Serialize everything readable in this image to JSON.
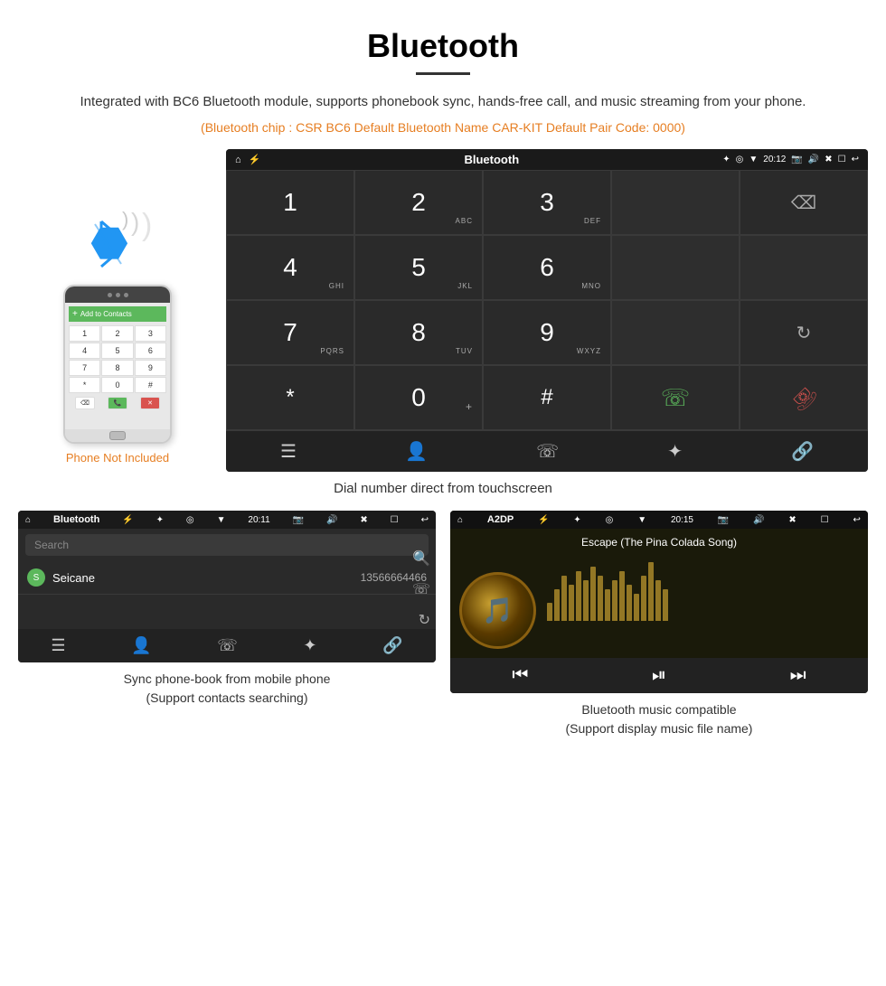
{
  "header": {
    "title": "Bluetooth",
    "description": "Integrated with BC6 Bluetooth module, supports phonebook sync, hands-free call, and music streaming from your phone.",
    "specs": "(Bluetooth chip : CSR BC6    Default Bluetooth Name CAR-KIT    Default Pair Code: 0000)"
  },
  "dialpad_screen": {
    "status_bar": {
      "screen_name": "Bluetooth",
      "time": "20:12"
    },
    "keys": [
      {
        "main": "1",
        "sub": ""
      },
      {
        "main": "2",
        "sub": "ABC"
      },
      {
        "main": "3",
        "sub": "DEF"
      },
      {
        "main": "",
        "sub": ""
      },
      {
        "main": "⌫",
        "sub": ""
      },
      {
        "main": "4",
        "sub": "GHI"
      },
      {
        "main": "5",
        "sub": "JKL"
      },
      {
        "main": "6",
        "sub": "MNO"
      },
      {
        "main": "",
        "sub": ""
      },
      {
        "main": "",
        "sub": ""
      },
      {
        "main": "7",
        "sub": "PQRS"
      },
      {
        "main": "8",
        "sub": "TUV"
      },
      {
        "main": "9",
        "sub": "WXYZ"
      },
      {
        "main": "",
        "sub": ""
      },
      {
        "main": "↺",
        "sub": ""
      },
      {
        "main": "*",
        "sub": ""
      },
      {
        "main": "0",
        "sub": "+"
      },
      {
        "main": "#",
        "sub": ""
      },
      {
        "main": "📞",
        "sub": ""
      },
      {
        "main": "📵",
        "sub": ""
      }
    ],
    "caption": "Dial number direct from touchscreen"
  },
  "phone": {
    "not_included_label": "Phone Not Included",
    "add_contacts_label": "Add to Contacts"
  },
  "phonebook_screen": {
    "status_bar": {
      "screen_name": "Bluetooth",
      "time": "20:11"
    },
    "search_placeholder": "Search",
    "contacts": [
      {
        "letter": "S",
        "name": "Seicane",
        "number": "13566664466"
      }
    ],
    "caption": "Sync phone-book from mobile phone\n(Support contacts searching)"
  },
  "music_screen": {
    "status_bar": {
      "screen_name": "A2DP",
      "time": "20:15"
    },
    "song_title": "Escape (The Pina Colada Song)",
    "eq_bars": [
      20,
      35,
      50,
      40,
      55,
      45,
      60,
      50,
      35,
      45,
      55,
      40,
      30,
      50,
      65,
      45,
      35
    ],
    "caption": "Bluetooth music compatible\n(Support display music file name)"
  }
}
